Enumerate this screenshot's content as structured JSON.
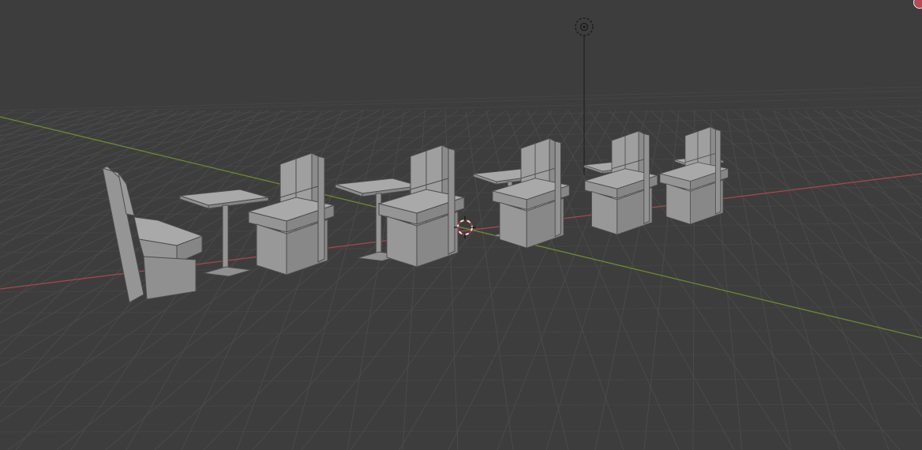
{
  "viewport": {
    "header_text": "",
    "background_color": "#3d3d3d",
    "grid_color": "#4a4a4a",
    "x_axis_color": "#a8484d",
    "y_axis_color": "#6d8a2e",
    "mesh_face_color": "#9a9a9a"
  },
  "scene": {
    "objects": [
      {
        "name": "booth-seat"
      },
      {
        "name": "table"
      },
      {
        "name": "booth-seat"
      },
      {
        "name": "table"
      },
      {
        "name": "booth-seat"
      },
      {
        "name": "table"
      },
      {
        "name": "booth-seat"
      },
      {
        "name": "table"
      },
      {
        "name": "booth-seat"
      },
      {
        "name": "table"
      },
      {
        "name": "booth-seat"
      }
    ],
    "light": {
      "type": "point-light"
    },
    "cursor": {
      "type": "3d-cursor"
    }
  }
}
